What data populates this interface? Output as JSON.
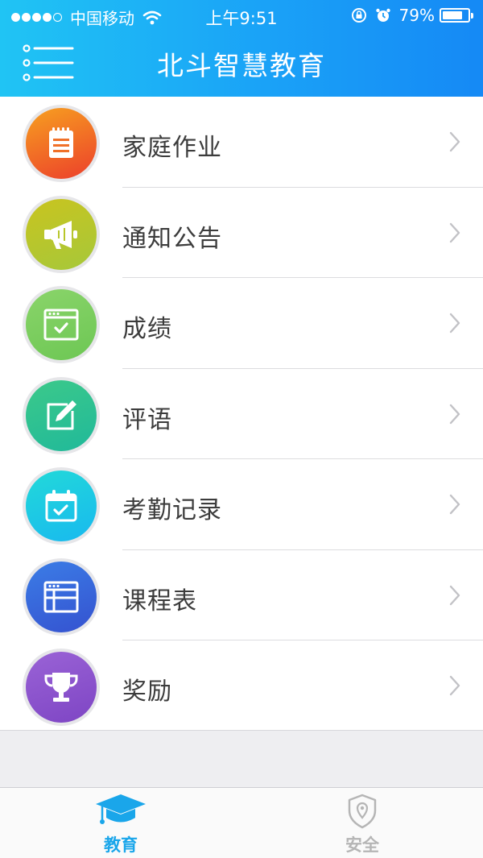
{
  "status_bar": {
    "carrier": "中国移动",
    "time": "上午9:51",
    "battery_percent": "79%",
    "battery_level": 0.79,
    "signal_strength": 4
  },
  "header": {
    "title": "北斗智慧教育"
  },
  "menu_items": [
    {
      "label": "家庭作业",
      "icon": "notepad-icon",
      "gradient": [
        "#f7a020",
        "#ec3f2b"
      ]
    },
    {
      "label": "通知公告",
      "icon": "megaphone-icon",
      "gradient": [
        "#c9c41f",
        "#a6c83a"
      ]
    },
    {
      "label": "成绩",
      "icon": "browser-check-icon",
      "gradient": [
        "#8ad46a",
        "#6dc754"
      ]
    },
    {
      "label": "评语",
      "icon": "edit-icon",
      "gradient": [
        "#3cc98a",
        "#20b99a"
      ]
    },
    {
      "label": "考勤记录",
      "icon": "calendar-check-icon",
      "gradient": [
        "#22d9d9",
        "#18b9ef"
      ]
    },
    {
      "label": "课程表",
      "icon": "timetable-icon",
      "gradient": [
        "#3b7de6",
        "#3552d0"
      ]
    },
    {
      "label": "奖励",
      "icon": "trophy-icon",
      "gradient": [
        "#9a63d6",
        "#7e45c4"
      ]
    }
  ],
  "tabbar": {
    "tabs": [
      {
        "label": "教育",
        "icon": "graduation-cap-icon",
        "active": true
      },
      {
        "label": "安全",
        "icon": "shield-location-icon",
        "active": false
      }
    ]
  },
  "colors": {
    "header_start": "#20c4f4",
    "header_end": "#1589f5",
    "tab_active": "#1aa6ea",
    "tab_inactive": "#b5b5b5"
  }
}
